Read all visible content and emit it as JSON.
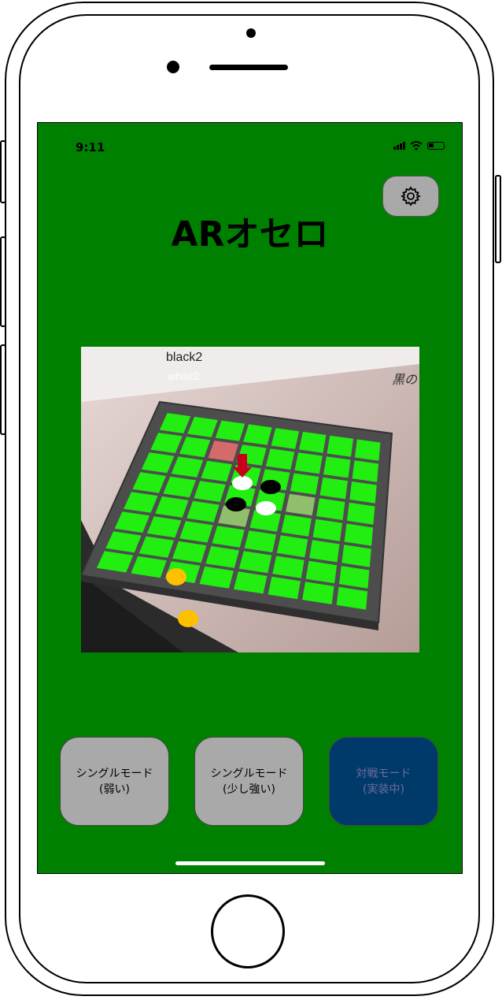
{
  "status": {
    "time": "9:11"
  },
  "app": {
    "title": "ARオセロ"
  },
  "settings": {
    "icon": "gear-icon"
  },
  "ar_view": {
    "label_black": "black2",
    "label_white": "white2",
    "label_japanese": "黒の"
  },
  "modes": [
    {
      "label": "シングルモード\n(弱い)"
    },
    {
      "label": "シングルモード\n(少し強い)"
    },
    {
      "label": "対戦モード\n(実装中)"
    }
  ],
  "colors": {
    "screen_bg": "#008000",
    "board_cell": "#22ee11",
    "button_gray": "#a9a9a9",
    "button_blue": "#003a6b"
  }
}
